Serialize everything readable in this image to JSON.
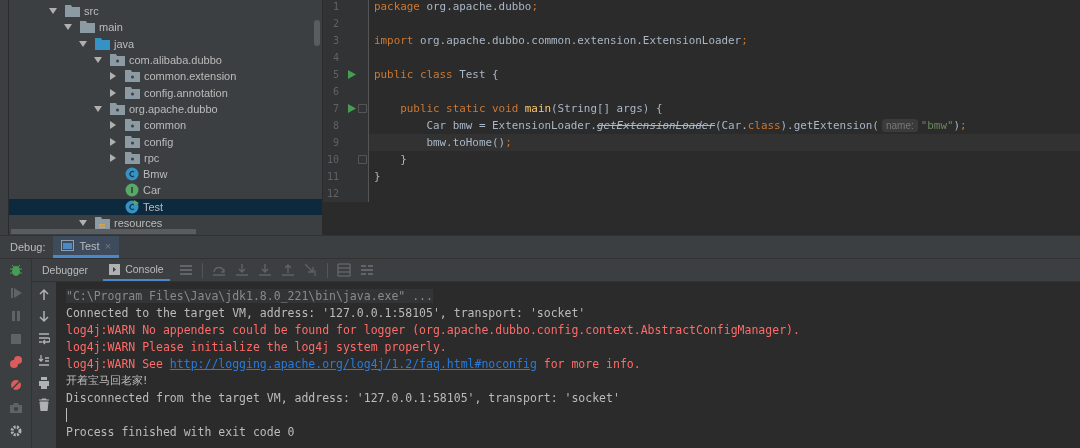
{
  "project_tree": [
    {
      "label": "src",
      "kind": "folder",
      "expanded": true,
      "selected": false,
      "children": [
        {
          "label": "main",
          "kind": "folder",
          "expanded": true,
          "selected": false,
          "children": [
            {
              "label": "java",
              "kind": "source_folder",
              "expanded": true,
              "selected": false,
              "children": [
                {
                  "label": "com.alibaba.dubbo",
                  "kind": "package",
                  "expanded": true,
                  "selected": false,
                  "children": [
                    {
                      "label": "common.extension",
                      "kind": "package",
                      "expanded": false,
                      "selected": false
                    },
                    {
                      "label": "config.annotation",
                      "kind": "package",
                      "expanded": false,
                      "selected": false
                    }
                  ]
                },
                {
                  "label": "org.apache.dubbo",
                  "kind": "package",
                  "expanded": true,
                  "selected": false,
                  "children": [
                    {
                      "label": "common",
                      "kind": "package",
                      "expanded": false,
                      "selected": false
                    },
                    {
                      "label": "config",
                      "kind": "package",
                      "expanded": false,
                      "selected": false
                    },
                    {
                      "label": "rpc",
                      "kind": "package",
                      "expanded": false,
                      "selected": false
                    },
                    {
                      "label": "Bmw",
                      "kind": "class",
                      "selected": false
                    },
                    {
                      "label": "Car",
                      "kind": "interface",
                      "selected": false
                    },
                    {
                      "label": "Test",
                      "kind": "runnable_class",
                      "selected": true
                    }
                  ]
                }
              ]
            },
            {
              "label": "resources",
              "kind": "resources",
              "expanded": true,
              "selected": false
            }
          ]
        }
      ]
    }
  ],
  "editor": {
    "lines": [
      {
        "number": "1",
        "tokens": [
          {
            "text": "package",
            "kind": "keyword"
          },
          {
            "text": " org.apache.dubbo",
            "kind": "plain"
          },
          {
            "text": ";",
            "kind": "keyword"
          }
        ]
      },
      {
        "number": "2"
      },
      {
        "number": "3",
        "tokens": [
          {
            "text": "import",
            "kind": "keyword"
          },
          {
            "text": " org.apache.dubbo.common.extension.ExtensionLoader",
            "kind": "plain"
          },
          {
            "text": ";",
            "kind": "keyword"
          }
        ]
      },
      {
        "number": "4"
      },
      {
        "number": "5",
        "run": true,
        "tokens": [
          {
            "text": "public class",
            "kind": "keyword"
          },
          {
            "text": " Test {",
            "kind": "plain"
          }
        ]
      },
      {
        "number": "6"
      },
      {
        "number": "7",
        "run": true,
        "fold": true,
        "tokens": [
          {
            "text": "    public static void ",
            "kind": "keyword"
          },
          {
            "text": "main",
            "kind": "method"
          },
          {
            "text": "(String[] args) {",
            "kind": "plain"
          }
        ]
      },
      {
        "number": "8",
        "tokens": [
          {
            "text": "        Car bmw = ExtensionLoader.",
            "kind": "plain"
          },
          {
            "text": "getExtensionLoader",
            "kind": "deprecated"
          },
          {
            "text": "(Car.",
            "kind": "plain"
          },
          {
            "text": "class",
            "kind": "keyword"
          },
          {
            "text": ").getExtension(",
            "kind": "plain"
          },
          {
            "text": "name:",
            "kind": "hint"
          },
          {
            "text": "\"bmw\"",
            "kind": "string"
          },
          {
            "text": ")",
            "kind": "plain"
          },
          {
            "text": ";",
            "kind": "keyword"
          }
        ]
      },
      {
        "number": "9",
        "current": true,
        "tokens": [
          {
            "text": "        bmw.toHome()",
            "kind": "plain"
          },
          {
            "text": ";",
            "kind": "keyword"
          }
        ]
      },
      {
        "number": "10",
        "fold": true,
        "tokens": [
          {
            "text": "    }",
            "kind": "plain"
          }
        ]
      },
      {
        "number": "11",
        "tokens": [
          {
            "text": "}",
            "kind": "plain"
          }
        ]
      },
      {
        "number": "12"
      }
    ]
  },
  "debug": {
    "title": "Debug:",
    "session_tabs": [
      {
        "label": "Test",
        "close": "×",
        "selected": true
      }
    ],
    "tabs": [
      {
        "label": "Debugger",
        "selected": false
      },
      {
        "label": "Console",
        "selected": true
      }
    ],
    "console": [
      {
        "kind": "command",
        "segments": [
          {
            "text": "\"C:\\Program Files\\Java\\jdk1.8.0_221\\bin\\java.exe\" ..."
          }
        ]
      },
      {
        "kind": "info",
        "segments": [
          {
            "text": "Connected to the target VM, address: '127.0.0.1:58105', transport: 'socket'"
          }
        ]
      },
      {
        "kind": "warn",
        "segments": [
          {
            "text": "log4j:WARN No appenders could be found for logger (org.apache.dubbo.config.context.AbstractConfigManager)."
          }
        ]
      },
      {
        "kind": "warn",
        "segments": [
          {
            "text": "log4j:WARN Please initialize the log4j system properly."
          }
        ]
      },
      {
        "kind": "warn",
        "segments": [
          {
            "text": "log4j:WARN See "
          },
          {
            "text": "http://logging.apache.org/log4j/1.2/faq.html#noconfig",
            "kind": "link"
          },
          {
            "text": " for more info."
          }
        ]
      },
      {
        "kind": "info",
        "segments": [
          {
            "text": "开着宝马回老家!"
          }
        ]
      },
      {
        "kind": "info",
        "segments": [
          {
            "text": "Disconnected from the target VM, address: '127.0.0.1:58105', transport: 'socket'"
          }
        ]
      },
      {
        "kind": "caret"
      },
      {
        "kind": "info",
        "segments": [
          {
            "text": "Process finished with exit code 0"
          }
        ]
      }
    ]
  }
}
